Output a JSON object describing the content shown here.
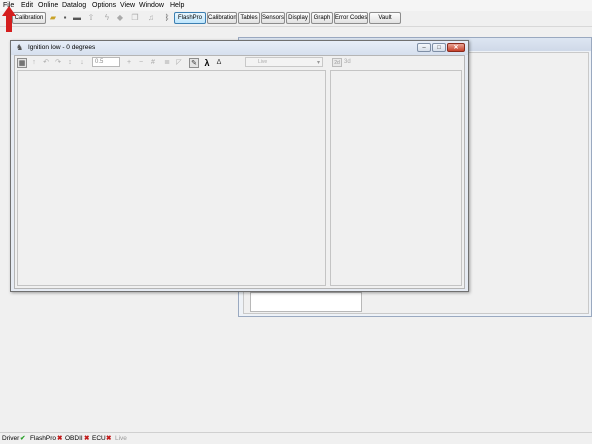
{
  "menubar": {
    "items": [
      "File",
      "Edit",
      "Online",
      "Datalog",
      "Options",
      "View",
      "Window",
      "Help"
    ]
  },
  "toolbar": {
    "calibration_dropdown": "Calibration",
    "buttons": [
      "FlashPro",
      "Calibration",
      "Tables",
      "Sensors",
      "Display",
      "Graph",
      "Error Codes",
      "Vault"
    ],
    "active_button": "FlashPro"
  },
  "child_window": {
    "title": "Ignition low - 0 degrees",
    "value_input": "0.5",
    "live_label": "Live",
    "view_2d": "2d",
    "view_3d": "3d"
  },
  "statusbar": {
    "items": [
      {
        "label": "Driver",
        "status": "ok"
      },
      {
        "label": "FlashPro",
        "status": "bad"
      },
      {
        "label": "OBDII",
        "status": "bad"
      },
      {
        "label": "ECU",
        "status": "bad"
      },
      {
        "label": "Live",
        "status": "none"
      }
    ]
  },
  "colors": {
    "annotation_arrow": "#d41e1e",
    "status_ok": "#2aa02a",
    "status_bad": "#c21a1a"
  }
}
